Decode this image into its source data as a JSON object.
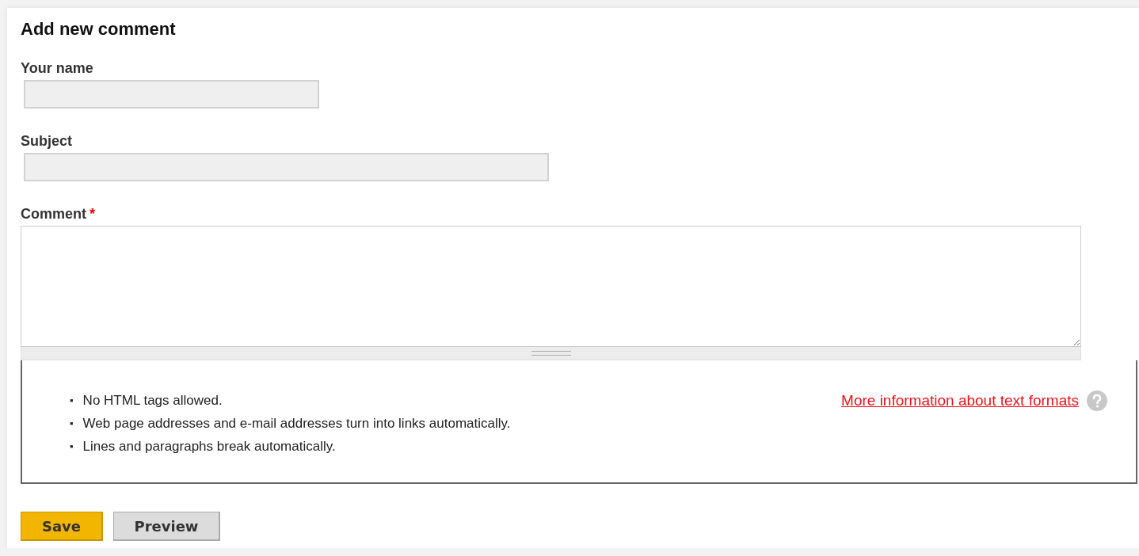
{
  "heading": "Add new comment",
  "fields": [
    {
      "kind": "short_text",
      "label": "Your name"
    },
    {
      "kind": "long_text",
      "label": "Subject"
    },
    {
      "kind": "textarea",
      "label": "Comment",
      "required_mark": "*"
    }
  ],
  "format_tips": {
    "items": [
      {
        "bullet": "▪",
        "text": "No HTML tags allowed."
      },
      {
        "bullet": "▪",
        "text": "Web page addresses and e-mail addresses turn into links automatically."
      },
      {
        "bullet": "▪",
        "text": "Lines and paragraphs break automatically."
      }
    ],
    "link": "More information about text formats"
  },
  "buttons": [
    {
      "label": "Save",
      "primary": true
    },
    {
      "label": "Preview",
      "primary": false
    }
  ]
}
